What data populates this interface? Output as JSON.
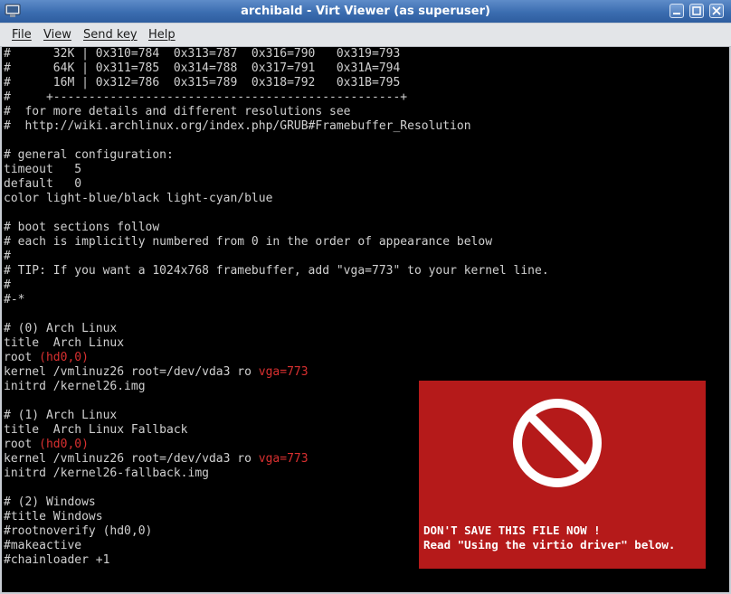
{
  "window": {
    "title": "archibald - Virt Viewer (as superuser)"
  },
  "menu": {
    "file": "File",
    "view": "View",
    "send_key": "Send key",
    "help": "Help"
  },
  "terminal": {
    "lines": [
      "#      32K | 0x310=784  0x313=787  0x316=790   0x319=793",
      "#      64K | 0x311=785  0x314=788  0x317=791   0x31A=794",
      "#      16M | 0x312=786  0x315=789  0x318=792   0x31B=795",
      "#     +-------------------------------------------------+",
      "#  for more details and different resolutions see",
      "#  http://wiki.archlinux.org/index.php/GRUB#Framebuffer_Resolution",
      "",
      "# general configuration:",
      "timeout   5",
      "default   0",
      "color light-blue/black light-cyan/blue",
      "",
      "# boot sections follow",
      "# each is implicitly numbered from 0 in the order of appearance below",
      "#",
      "# TIP: If you want a 1024x768 framebuffer, add \"vga=773\" to your kernel line.",
      "#",
      "#-*",
      "",
      "# (0) Arch Linux",
      "title  Arch Linux",
      "root ",
      "kernel /vmlinuz26 root=/dev/vda3 ro ",
      "initrd /kernel26.img",
      "",
      "# (1) Arch Linux",
      "title  Arch Linux Fallback",
      "root ",
      "kernel /vmlinuz26 root=/dev/vda3 ro ",
      "initrd /kernel26-fallback.img",
      "",
      "# (2) Windows",
      "#title Windows",
      "#rootnoverify (hd0,0)",
      "#makeactive",
      "#chainloader +1"
    ],
    "highlight_hd": "(hd0,0)",
    "highlight_vga": "vga=773",
    "highlight_color": "#d93030"
  },
  "notice": {
    "line1": "DON'T SAVE THIS FILE NOW !",
    "line2": "Read \"Using the virtio driver\" below.",
    "background": "#b51a1a",
    "icon": "no-entry-icon"
  }
}
